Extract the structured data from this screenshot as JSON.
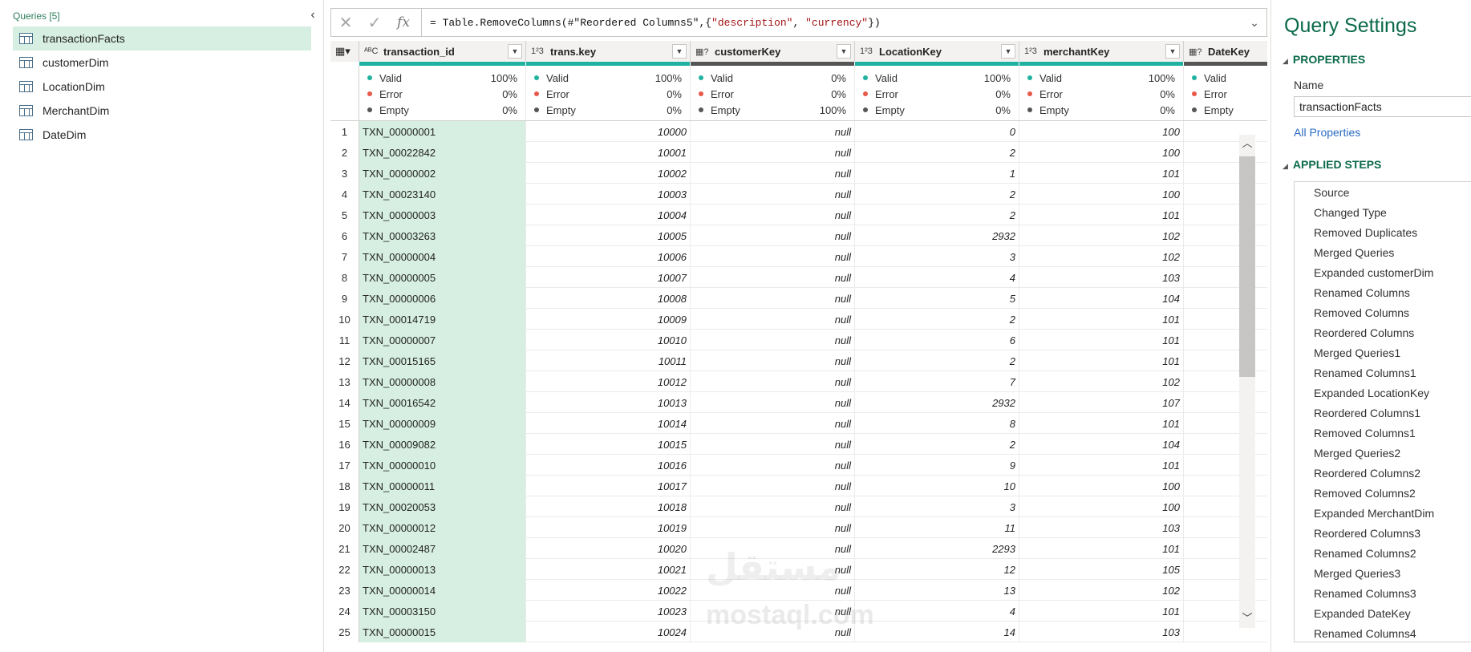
{
  "queries_pane": {
    "header": "Queries [5]",
    "items": [
      {
        "label": "transactionFacts",
        "selected": true
      },
      {
        "label": "customerDim",
        "selected": false
      },
      {
        "label": "LocationDim",
        "selected": false
      },
      {
        "label": "MerchantDim",
        "selected": false
      },
      {
        "label": "DateDim",
        "selected": false
      }
    ]
  },
  "formula_bar": {
    "formula_prefix": "= Table.RemoveColumns(#\"Reordered Columns5\",{",
    "str1": "\"description\"",
    "sep": ", ",
    "str2": "\"currency\"",
    "formula_suffix": "})"
  },
  "grid": {
    "columns": [
      {
        "type": "ABC",
        "name": "transaction_id",
        "quality_color": "#20b2a0"
      },
      {
        "type": "123",
        "name": "trans.key",
        "quality_color": "#20b2a0"
      },
      {
        "type": "ABC?",
        "name": "customerKey",
        "quality_color": "#555555"
      },
      {
        "type": "123",
        "name": "LocationKey",
        "quality_color": "#20b2a0"
      },
      {
        "type": "123",
        "name": "merchantKey",
        "quality_color": "#20b2a0"
      },
      {
        "type": "cal?",
        "name": "DateKey",
        "quality_color": "#555555"
      }
    ],
    "profile": [
      {
        "valid": "100%",
        "error": "0%",
        "empty": "0%"
      },
      {
        "valid": "100%",
        "error": "0%",
        "empty": "0%"
      },
      {
        "valid": "0%",
        "error": "0%",
        "empty": "100%"
      },
      {
        "valid": "100%",
        "error": "0%",
        "empty": "0%"
      },
      {
        "valid": "100%",
        "error": "0%",
        "empty": "0%"
      },
      {
        "valid": "",
        "error": "",
        "empty": ""
      }
    ],
    "profile_labels": {
      "valid": "Valid",
      "error": "Error",
      "empty": "Empty"
    },
    "rows": [
      [
        "1",
        "TXN_00000001",
        "10000",
        "null",
        "0",
        "100"
      ],
      [
        "2",
        "TXN_00022842",
        "10001",
        "null",
        "2",
        "100"
      ],
      [
        "3",
        "TXN_00000002",
        "10002",
        "null",
        "1",
        "101"
      ],
      [
        "4",
        "TXN_00023140",
        "10003",
        "null",
        "2",
        "100"
      ],
      [
        "5",
        "TXN_00000003",
        "10004",
        "null",
        "2",
        "101"
      ],
      [
        "6",
        "TXN_00003263",
        "10005",
        "null",
        "2932",
        "102"
      ],
      [
        "7",
        "TXN_00000004",
        "10006",
        "null",
        "3",
        "102"
      ],
      [
        "8",
        "TXN_00000005",
        "10007",
        "null",
        "4",
        "103"
      ],
      [
        "9",
        "TXN_00000006",
        "10008",
        "null",
        "5",
        "104"
      ],
      [
        "10",
        "TXN_00014719",
        "10009",
        "null",
        "2",
        "101"
      ],
      [
        "11",
        "TXN_00000007",
        "10010",
        "null",
        "6",
        "101"
      ],
      [
        "12",
        "TXN_00015165",
        "10011",
        "null",
        "2",
        "101"
      ],
      [
        "13",
        "TXN_00000008",
        "10012",
        "null",
        "7",
        "102"
      ],
      [
        "14",
        "TXN_00016542",
        "10013",
        "null",
        "2932",
        "107"
      ],
      [
        "15",
        "TXN_00000009",
        "10014",
        "null",
        "8",
        "101"
      ],
      [
        "16",
        "TXN_00009082",
        "10015",
        "null",
        "2",
        "104"
      ],
      [
        "17",
        "TXN_00000010",
        "10016",
        "null",
        "9",
        "101"
      ],
      [
        "18",
        "TXN_00000011",
        "10017",
        "null",
        "10",
        "100"
      ],
      [
        "19",
        "TXN_00020053",
        "10018",
        "null",
        "3",
        "100"
      ],
      [
        "20",
        "TXN_00000012",
        "10019",
        "null",
        "11",
        "103"
      ],
      [
        "21",
        "TXN_00002487",
        "10020",
        "null",
        "2293",
        "101"
      ],
      [
        "22",
        "TXN_00000013",
        "10021",
        "null",
        "12",
        "105"
      ],
      [
        "23",
        "TXN_00000014",
        "10022",
        "null",
        "13",
        "102"
      ],
      [
        "24",
        "TXN_00003150",
        "10023",
        "null",
        "4",
        "101"
      ],
      [
        "25",
        "TXN_00000015",
        "10024",
        "null",
        "14",
        "103"
      ]
    ]
  },
  "settings": {
    "title": "Query Settings",
    "properties_head": "PROPERTIES",
    "name_label": "Name",
    "name_value": "transactionFacts",
    "all_properties": "All Properties",
    "applied_steps_head": "APPLIED STEPS",
    "steps": [
      "Source",
      "Changed Type",
      "Removed Duplicates",
      "Merged Queries",
      "Expanded customerDim",
      "Renamed Columns",
      "Removed Columns",
      "Reordered Columns",
      "Merged Queries1",
      "Renamed Columns1",
      "Expanded LocationKey",
      "Reordered Columns1",
      "Removed Columns1",
      "Merged Queries2",
      "Reordered Columns2",
      "Removed Columns2",
      "Expanded MerchantDim",
      "Reordered Columns3",
      "Renamed Columns2",
      "Merged Queries3",
      "Renamed Columns3",
      "Expanded DateKey",
      "Renamed Columns4"
    ]
  },
  "watermark": {
    "main": "مستقل",
    "sub": "mostaql.com"
  },
  "colors": {
    "accent_green": "#0b6a4a",
    "selection": "#d6efe2",
    "valid": "#20b2a0",
    "error": "#e8584a",
    "link": "#2b6cc4"
  }
}
